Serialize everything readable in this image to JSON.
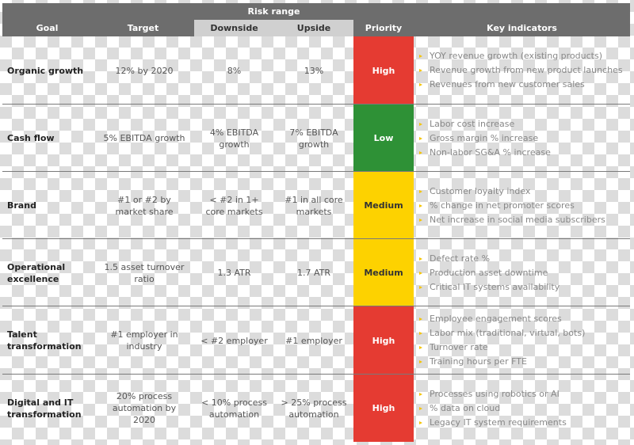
{
  "header": {
    "risk_range": "Risk range",
    "goal": "Goal",
    "target": "Target",
    "downside": "Downside",
    "upside": "Upside",
    "priority": "Priority",
    "key_indicators": "Key indicators"
  },
  "colors": {
    "high": "#e53b32",
    "low": "#2e9136",
    "medium": "#fdd200",
    "header": "#6d6d6d",
    "subheader": "#d0d0d0"
  },
  "rows": [
    {
      "goal": "Organic growth",
      "target": "12% by 2020",
      "downside": "8%",
      "upside": "13%",
      "priority": "High",
      "indicators": [
        "YOY revenue growth (existing products)",
        "Revenue growth from new product launches",
        "Revenues from new customer sales"
      ]
    },
    {
      "goal": "Cash flow",
      "target": "5% EBITDA growth",
      "downside": "4% EBITDA growth",
      "upside": "7% EBITDA growth",
      "priority": "Low",
      "indicators": [
        "Labor cost increase",
        "Gross margin % increase",
        "Non-labor SG&A % increase"
      ]
    },
    {
      "goal": "Brand",
      "target": "#1 or #2 by market share",
      "downside": "< #2 in 1+ core markets",
      "upside": "#1 in all core markets",
      "priority": "Medium",
      "indicators": [
        "Customer loyalty index",
        "% change in net promoter scores",
        "Net increase in social media subscribers"
      ]
    },
    {
      "goal": "Operational excellence",
      "target": "1.5 asset turnover ratio",
      "downside": "1.3 ATR",
      "upside": "1.7 ATR",
      "priority": "Medium",
      "indicators": [
        "Defect rate %",
        "Production asset downtime",
        "Critical IT systems availability"
      ]
    },
    {
      "goal": "Talent transformation",
      "target": "#1 employer in industry",
      "downside": "< #2 employer",
      "upside": "#1 employer",
      "priority": "High",
      "indicators": [
        "Employee engagement scores",
        "Labor mix (traditional, virtual, bots)",
        "Turnover rate",
        "Training hours per FTE"
      ]
    },
    {
      "goal": "Digital and IT transformation",
      "target": "20% process automation by 2020",
      "downside": "< 10% process automation",
      "upside": "> 25% process automation",
      "priority": "High",
      "indicators": [
        "Processes using robotics or AI",
        "% data on cloud",
        "Legacy IT system requirements"
      ]
    }
  ]
}
